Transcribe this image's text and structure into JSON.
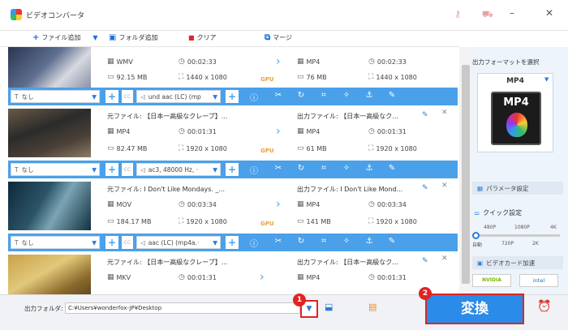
{
  "app": {
    "title": "ビデオコンバータ"
  },
  "toolbar": {
    "add_file": "ファイル追加",
    "add_folder": "フォルダ追加",
    "clear": "クリア",
    "merge": "マージ"
  },
  "files": [
    {
      "src_format": "WMV",
      "src_duration": "00:02:33",
      "src_size": "92.15 MB",
      "src_res": "1440 x 1080",
      "out_format": "MP4",
      "out_duration": "00:02:33",
      "out_size": "76 MB",
      "out_res": "1440 x 1080",
      "subtitle": "なし",
      "audio": "und aac (LC) (mp"
    },
    {
      "src_name": "元ファイル: 【日本一高級なクレープ】...",
      "out_name": "出力ファイル: 【日本一高級なク...",
      "src_format": "MP4",
      "src_duration": "00:01:31",
      "src_size": "82.47 MB",
      "src_res": "1920 x 1080",
      "out_format": "MP4",
      "out_duration": "00:01:31",
      "out_size": "61 MB",
      "out_res": "1920 x 1080",
      "subtitle": "なし",
      "audio": "ac3, 48000 Hz, ·"
    },
    {
      "src_name": "元ファイル: I Don't Like Mondays. _...",
      "out_name": "出力ファイル: I Don't Like Mond...",
      "src_format": "MOV",
      "src_duration": "00:03:34",
      "src_size": "184.17 MB",
      "src_res": "1920 x 1080",
      "out_format": "MP4",
      "out_duration": "00:03:34",
      "out_size": "141 MB",
      "out_res": "1920 x 1080",
      "subtitle": "なし",
      "audio": "aac (LC) (mp4a.·"
    },
    {
      "src_name": "元ファイル: 【日本一高級なクレープ】...",
      "out_name": "出力ファイル: 【日本一高級なク...",
      "src_format": "MKV",
      "src_duration": "00:01:31",
      "src_size": "",
      "src_res": "",
      "out_format": "MP4",
      "out_duration": "00:01:31",
      "out_size": "",
      "out_res": ""
    }
  ],
  "gpu_label": "GPU",
  "panel": {
    "select_label": "出力フォーマットを選択",
    "format": "MP4",
    "param_btn": "パラメータ設定",
    "quick_label": "クイック設定",
    "ticks_top": [
      "480P",
      "1080P",
      "4K"
    ],
    "ticks_bottom": [
      "自動",
      "720P",
      "2K"
    ],
    "gpu_btn": "ビデオカード加速",
    "nvidia": "NVIDIA",
    "intel": "intel"
  },
  "bottom": {
    "folder_label": "出力フォルダ:",
    "path": "C:¥Users¥wonderfox-JP¥Desktop",
    "convert": "変換",
    "badge1": "1",
    "badge2": "2"
  }
}
